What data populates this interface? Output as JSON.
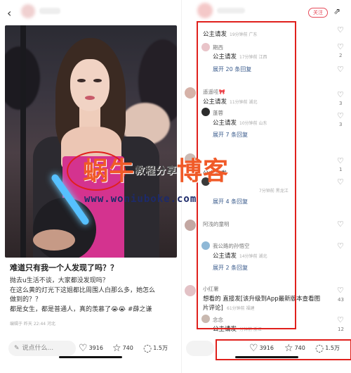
{
  "left": {
    "post_title": "难道只有我一个人发现了吗？？",
    "post_body": [
      "抛去u生活不谈，大家都没发现吗？",
      "在这么黄的灯光下这姐都比周围人白那么多，她怎么",
      "做到的？？",
      "都是女生，都是普通人，真的羡慕了😭😭 #薛之谦"
    ],
    "post_meta": "编辑于 昨天 22:44 河北",
    "comment_placeholder": "说点什么...",
    "likes": "3916",
    "stars": "740",
    "comments": "1.5万"
  },
  "right": {
    "follow_label": "关注",
    "comments": [
      {
        "name": "",
        "text": "公主请发",
        "meta": "19分钟前  广东"
      },
      {
        "name": "期西",
        "text": "公主请发",
        "meta": "17分钟前  江西"
      },
      {
        "expand": "展开 20 条回复"
      },
      {
        "name": "遥遥哇🎀",
        "text": "公主请发",
        "meta": "11分钟前  湖北"
      },
      {
        "name": "蓬蓉",
        "text": "公主请发",
        "meta": "10分钟前  山东"
      },
      {
        "expand": "展开 7 条回复"
      },
      {
        "name": "",
        "text": "公主请发",
        "meta": "15分钟前"
      },
      {
        "name": "",
        "text": "公主请发",
        "meta": ""
      },
      {
        "name": "",
        "text": "",
        "meta": "7分钟前  黑龙江"
      },
      {
        "name": "",
        "text": "展开 4 条回复",
        "meta": ""
      },
      {
        "name": "阿浅的童明",
        "text": "",
        "meta": ""
      },
      {
        "name": "我公路的孙悟空",
        "text": "公主请发",
        "meta": "14分钟前  湖北"
      },
      {
        "expand": "展开 2 条回复"
      },
      {
        "name": "小红薯",
        "text": "想看的 直接发[该升级到App最新版本查看图",
        "text2": "片评论]",
        "meta": "61分钟前  福建"
      },
      {
        "name": "念念",
        "text": "公主请发",
        "meta": "分钟前  浙江"
      }
    ],
    "heart_counts": [
      "2",
      "",
      "3",
      "",
      "3",
      "",
      "1",
      "",
      "",
      "",
      "",
      "43",
      "",
      "12"
    ],
    "likes": "3916",
    "stars": "740",
    "comments_count": "1.5万"
  },
  "watermark": {
    "main": "蜗牛",
    "mid": "教程分享",
    "tail": "博客",
    "url": "www.woniuboke.com"
  }
}
